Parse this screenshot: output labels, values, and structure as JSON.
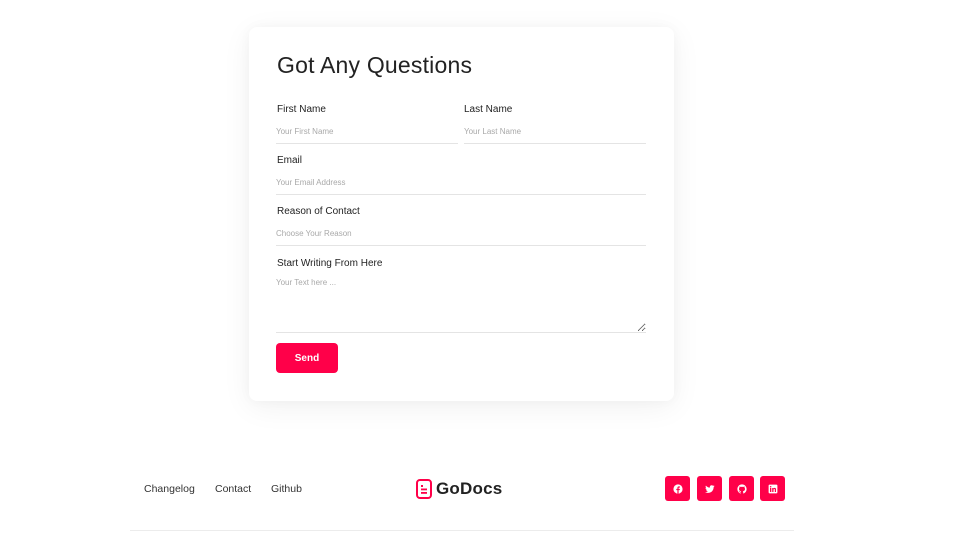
{
  "form": {
    "title": "Got Any Questions",
    "first_name": {
      "label": "First Name",
      "placeholder": "Your First Name",
      "value": ""
    },
    "last_name": {
      "label": "Last Name",
      "placeholder": "Your Last Name",
      "value": ""
    },
    "email": {
      "label": "Email",
      "placeholder": "Your Email Address",
      "value": ""
    },
    "reason": {
      "label": "Reason of Contact",
      "placeholder": "Choose Your Reason",
      "value": ""
    },
    "message": {
      "label": "Start Writing From Here",
      "placeholder": "Your Text here ...",
      "value": ""
    },
    "send_label": "Send"
  },
  "footer": {
    "links": [
      "Changelog",
      "Contact",
      "Github"
    ],
    "logo_text": "GoDocs",
    "social": [
      {
        "name": "facebook",
        "icon": "facebook-icon"
      },
      {
        "name": "twitter",
        "icon": "twitter-icon"
      },
      {
        "name": "github",
        "icon": "github-icon"
      },
      {
        "name": "linkedin",
        "icon": "linkedin-icon"
      }
    ]
  },
  "colors": {
    "accent": "#ff0049",
    "text": "#222222",
    "placeholder": "#a9a9a9",
    "border": "#e4e4e4"
  }
}
